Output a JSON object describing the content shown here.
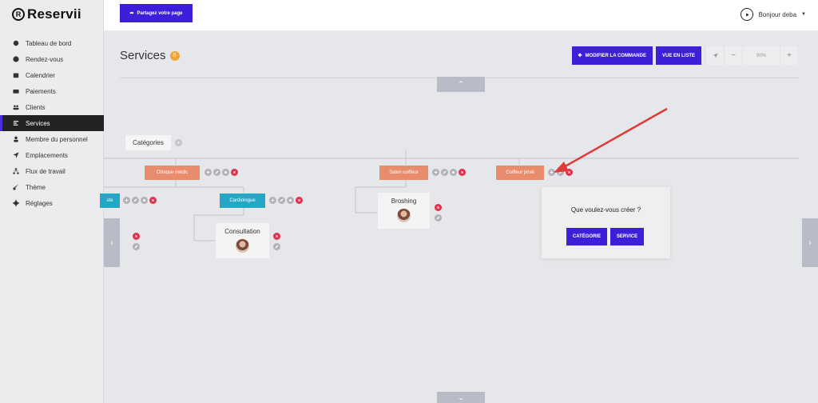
{
  "brand": {
    "name": "Reservii",
    "mark": "R"
  },
  "topbar": {
    "share_label": "Partagez votre page",
    "greeting": "Bonjour deba"
  },
  "sidebar": {
    "items": [
      {
        "label": "Tableau de bord",
        "icon": "gauge-icon",
        "active": false
      },
      {
        "label": "Rendez-vous",
        "icon": "clock-icon",
        "active": false
      },
      {
        "label": "Calendrier",
        "icon": "calendar-icon",
        "active": false
      },
      {
        "label": "Paiements",
        "icon": "wallet-icon",
        "active": false
      },
      {
        "label": "Clients",
        "icon": "users-icon",
        "active": false
      },
      {
        "label": "Services",
        "icon": "list-icon",
        "active": true
      },
      {
        "label": "Membre du personnel",
        "icon": "user-icon",
        "active": false
      },
      {
        "label": "Emplacements",
        "icon": "location-arrow-icon",
        "active": false
      },
      {
        "label": "Flux de travail",
        "icon": "sitemap-icon",
        "active": false
      },
      {
        "label": "Thème",
        "icon": "brush-icon",
        "active": false
      },
      {
        "label": "Réglages",
        "icon": "cog-icon",
        "active": false
      }
    ]
  },
  "page": {
    "title": "Services",
    "count": "6"
  },
  "toolbar": {
    "modify_order_label": "MODIFIER LA COMMANDE",
    "list_view_label": "VUE EN LISTE",
    "zoom_minus": "−",
    "zoom_value": "90%",
    "zoom_plus": "+"
  },
  "tree": {
    "root_label": "Catégories",
    "categories": [
      {
        "label": "Clinique médic"
      },
      {
        "label": "Salon coiffeur"
      },
      {
        "label": "Coiffeur privé"
      }
    ],
    "subcategories": [
      {
        "label": "ste"
      },
      {
        "label": "Cardiologue"
      }
    ],
    "services": [
      {
        "label": "Consultation"
      },
      {
        "label": "Broshing"
      }
    ]
  },
  "popover": {
    "question": "Que voulez-vous créer ?",
    "category_button": "CATÉGORIE",
    "service_button": "SERVICE"
  },
  "colors": {
    "accent": "#3d1fd9",
    "category_node": "#e98b6d",
    "subcategory_node": "#22a8c6",
    "delete": "#e0334d",
    "annotation_arrow": "#e03b3b"
  }
}
